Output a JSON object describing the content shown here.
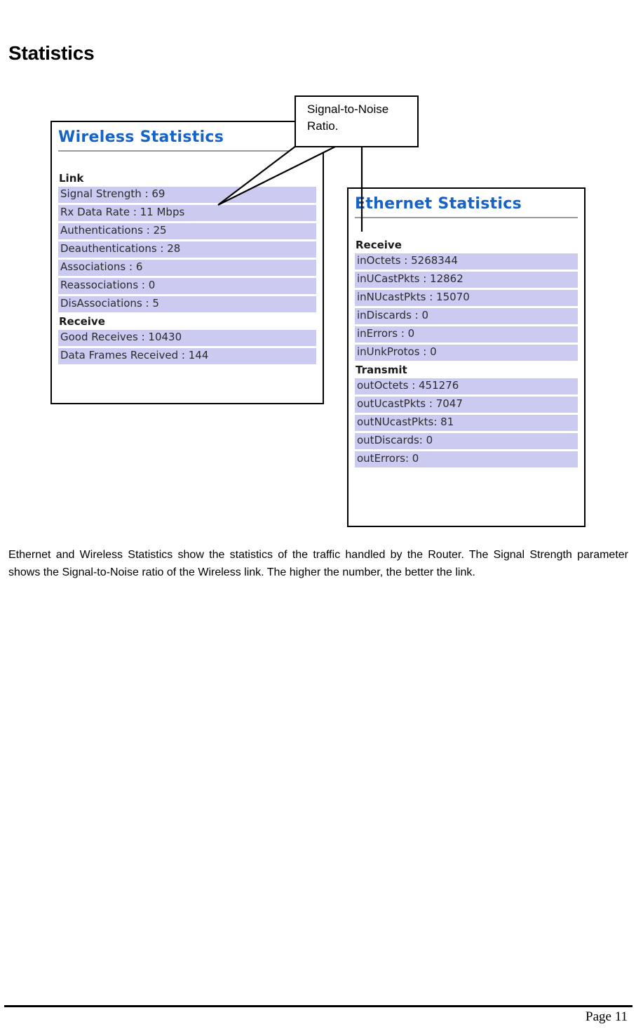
{
  "page": {
    "heading": "Statistics",
    "body_paragraph": "Ethernet and Wireless Statistics show the statistics of the traffic handled by the Router. The Signal Strength parameter shows the Signal-to-Noise ratio of the Wireless link. The higher the number, the better the link.",
    "footer_page_label": "Page 11"
  },
  "callout": {
    "text": "Signal-to-Noise Ratio.",
    "points_at": "Signal Strength : 69"
  },
  "wireless_panel": {
    "title": "Wireless Statistics",
    "groups": [
      {
        "label": "Link",
        "rows": [
          "Signal Strength : 69",
          "Rx Data Rate : 11 Mbps",
          "Authentications : 25",
          "Deauthentications : 28",
          "Associations : 6",
          "Reassociations : 0",
          "DisAssociations : 5"
        ]
      },
      {
        "label": "Receive",
        "rows": [
          "Good Receives : 10430",
          "Data Frames Received : 144"
        ]
      }
    ]
  },
  "ethernet_panel": {
    "title": "Ethernet Statistics",
    "groups": [
      {
        "label": "Receive",
        "rows": [
          "inOctets : 5268344",
          "inUCastPkts : 12862",
          "inNUcastPkts : 15070",
          "inDiscards : 0",
          "inErrors : 0",
          "inUnkProtos : 0"
        ]
      },
      {
        "label": "Transmit",
        "rows": [
          "outOctets : 451276",
          "outUcastPkts : 7047",
          "outNUcastPkts: 81",
          "outDiscards: 0",
          "outErrors: 0"
        ]
      }
    ]
  },
  "colors": {
    "panel_title": "#1663c8",
    "row_background": "#cbcbf2",
    "rule": "#9a9a9a",
    "border": "#000000"
  }
}
